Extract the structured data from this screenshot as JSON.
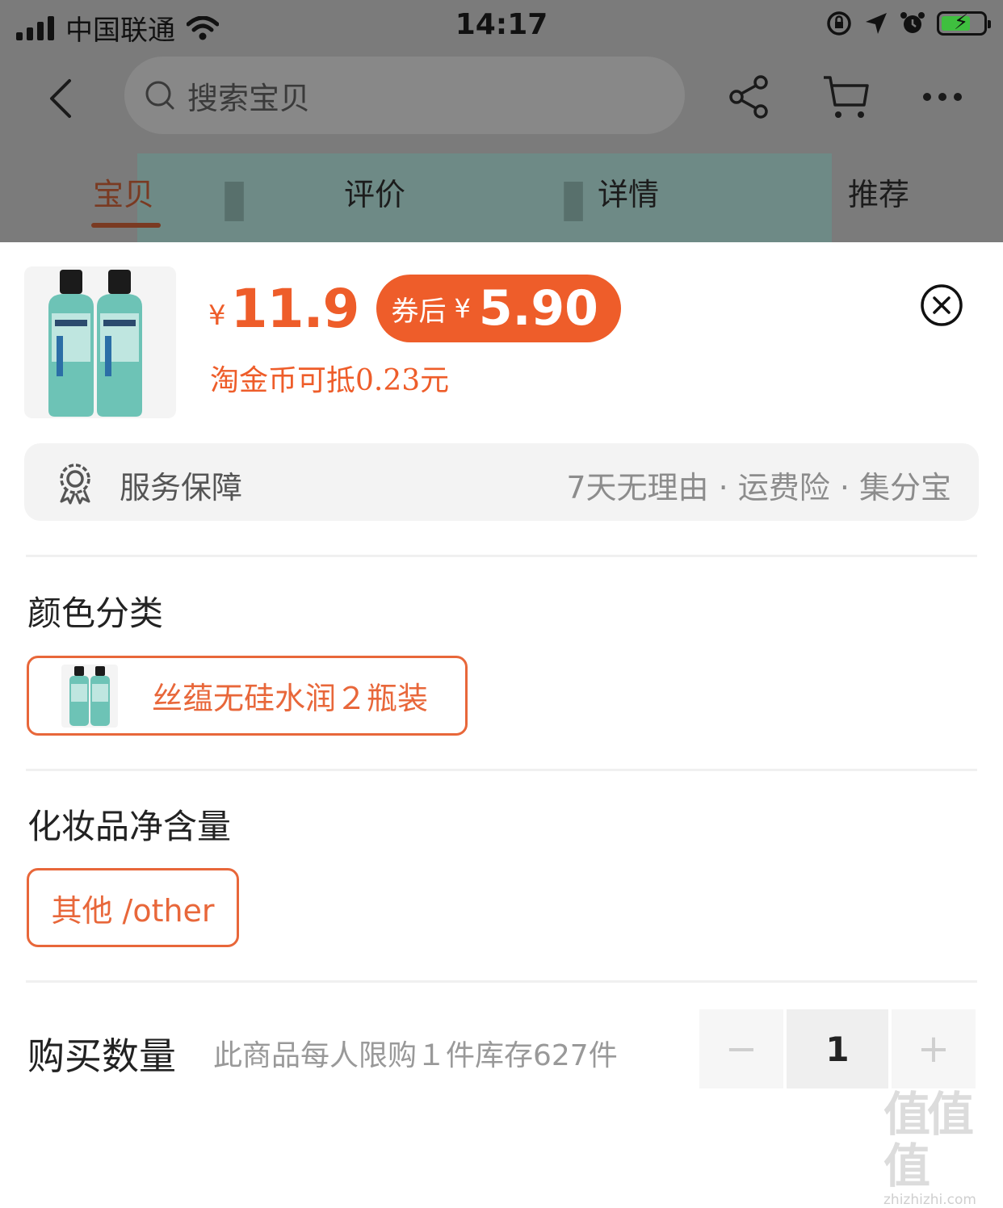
{
  "status_bar": {
    "carrier": "中国联通",
    "time": "14:17"
  },
  "header": {
    "search_placeholder": "搜索宝贝",
    "icons": [
      "back-icon",
      "share-icon",
      "cart-icon",
      "more-icon"
    ]
  },
  "tabs": [
    {
      "label": "宝贝",
      "active": true
    },
    {
      "label": "评价",
      "active": false
    },
    {
      "label": "详情",
      "active": false
    },
    {
      "label": "推荐",
      "active": false
    }
  ],
  "sheet": {
    "price_currency": "¥",
    "price": "11.9",
    "coupon_label": "券后",
    "coupon_currency": "¥",
    "coupon_price": "5.90",
    "coin_text": "淘金币可抵0.23元",
    "service_title": "服务保障",
    "service_items": "7天无理由 · 运费险 · 集分宝",
    "color_section_title": "颜色分类",
    "color_option": "丝蕴无硅水润２瓶装",
    "volume_section_title": "化妆品净含量",
    "volume_option": "其他 /other",
    "quantity_label": "购买数量",
    "quantity_note": "此商品每人限购１件库存627件",
    "quantity_value": "1",
    "minus_symbol": "−",
    "plus_symbol": "+"
  },
  "watermark": {
    "logo": "值值值",
    "url": "zhizhizhi.com"
  },
  "colors": {
    "accent": "#ee5d2a",
    "chip_border": "#e8673a",
    "bg_dim": "#7b7b7b"
  }
}
